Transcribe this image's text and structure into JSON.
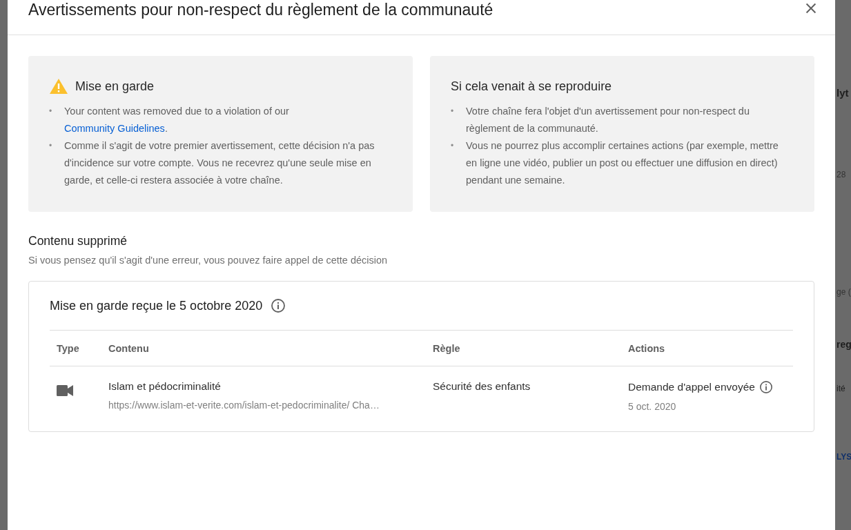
{
  "dialog": {
    "title": "Avertissements pour non-respect du règlement de la communauté"
  },
  "cards": [
    {
      "kind": "warning",
      "title": "Mise en garde",
      "bullets": [
        {
          "marker": "•",
          "text": "Your content was removed due to a violation of our ",
          "link": "Community Guidelines",
          "after": "."
        },
        {
          "marker": "•",
          "text": "Comme il s'agit de votre premier avertissement, cette décision n'a pas d'incidence sur votre compte. Vous ne recevrez qu'une seule mise en garde, et celle-ci restera associée à votre chaîne."
        }
      ]
    },
    {
      "kind": "plain",
      "title": "Si cela venait à se reproduire",
      "bullets": [
        {
          "marker": "•",
          "text": "Votre chaîne fera l'objet d'un avertissement pour non-respect du règlement de la communauté."
        },
        {
          "marker": "•",
          "text": "Vous ne pourrez plus accomplir certaines actions (par exemple, mettre en ligne une vidéo, publier un post ou effectuer une diffusion en direct) pendant une semaine."
        }
      ]
    }
  ],
  "removed": {
    "heading": "Contenu supprimé",
    "subtitle": "Si vous pensez qu'il s'agit d'une erreur, vous pouvez faire appel de cette décision"
  },
  "strike": {
    "title": "Mise en garde reçue le 5 octobre 2020",
    "columns": [
      "Type",
      "Contenu",
      "Règle",
      "Actions"
    ],
    "rows": [
      {
        "title": "Islam et pédocriminalité",
        "url": "https://www.islam-et-verite.com/islam-et-pedocriminalite/ Cha…",
        "rule": "Sécurité des enfants",
        "action": "Demande d'appel envoyée",
        "date": "5 oct. 2020"
      }
    ]
  },
  "background": [
    "lyt",
    "28",
    "ge (",
    "reg",
    "ité",
    "LYS"
  ]
}
